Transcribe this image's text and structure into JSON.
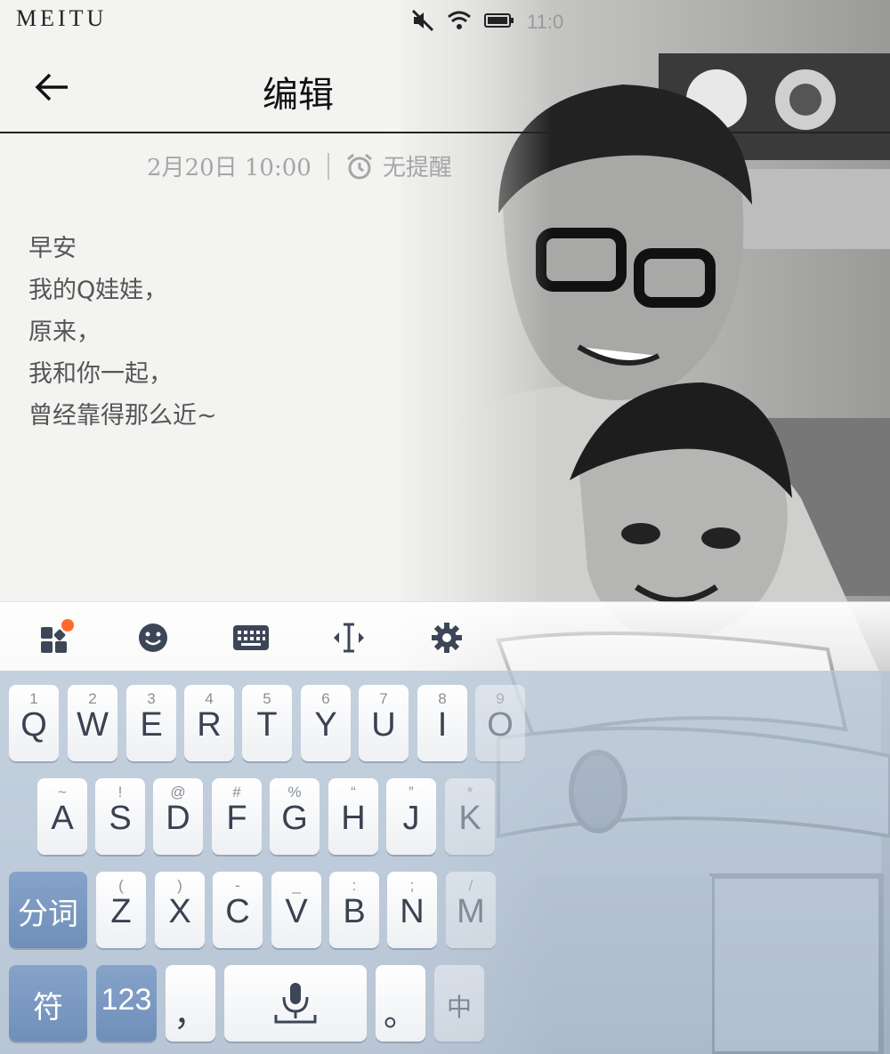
{
  "status_bar": {
    "brand": "MEITU",
    "time": "11:0"
  },
  "header": {
    "title": "编辑"
  },
  "meta": {
    "date": "2月20日 10:00",
    "reminder": "无提醒"
  },
  "note": {
    "lines": [
      "早安",
      "我的Q娃娃，",
      "原来，",
      "我和你一起，",
      "曾经靠得那么近~"
    ]
  },
  "keyboard": {
    "row1": [
      {
        "num": "1",
        "letter": "Q"
      },
      {
        "num": "2",
        "letter": "W"
      },
      {
        "num": "3",
        "letter": "E"
      },
      {
        "num": "4",
        "letter": "R"
      },
      {
        "num": "5",
        "letter": "T"
      },
      {
        "num": "6",
        "letter": "Y"
      },
      {
        "num": "7",
        "letter": "U"
      },
      {
        "num": "8",
        "letter": "I"
      },
      {
        "num": "9",
        "letter": "O"
      }
    ],
    "row2": [
      {
        "sym": "~",
        "letter": "A"
      },
      {
        "sym": "!",
        "letter": "S"
      },
      {
        "sym": "@",
        "letter": "D"
      },
      {
        "sym": "#",
        "letter": "F"
      },
      {
        "sym": "%",
        "letter": "G"
      },
      {
        "sym": "“",
        "letter": "H"
      },
      {
        "sym": "”",
        "letter": "J"
      },
      {
        "sym": "*",
        "letter": "K"
      }
    ],
    "row3": [
      {
        "sym": "(",
        "letter": "Z"
      },
      {
        "sym": ")",
        "letter": "X"
      },
      {
        "sym": "-",
        "letter": "C"
      },
      {
        "sym": "_",
        "letter": "V"
      },
      {
        "sym": ":",
        "letter": "B"
      },
      {
        "sym": ";",
        "letter": "N"
      },
      {
        "sym": "/",
        "letter": "M"
      }
    ],
    "fenci": "分词",
    "fu": "符",
    "num123": "123",
    "comma": "，",
    "period": "。",
    "zhong": "中"
  }
}
